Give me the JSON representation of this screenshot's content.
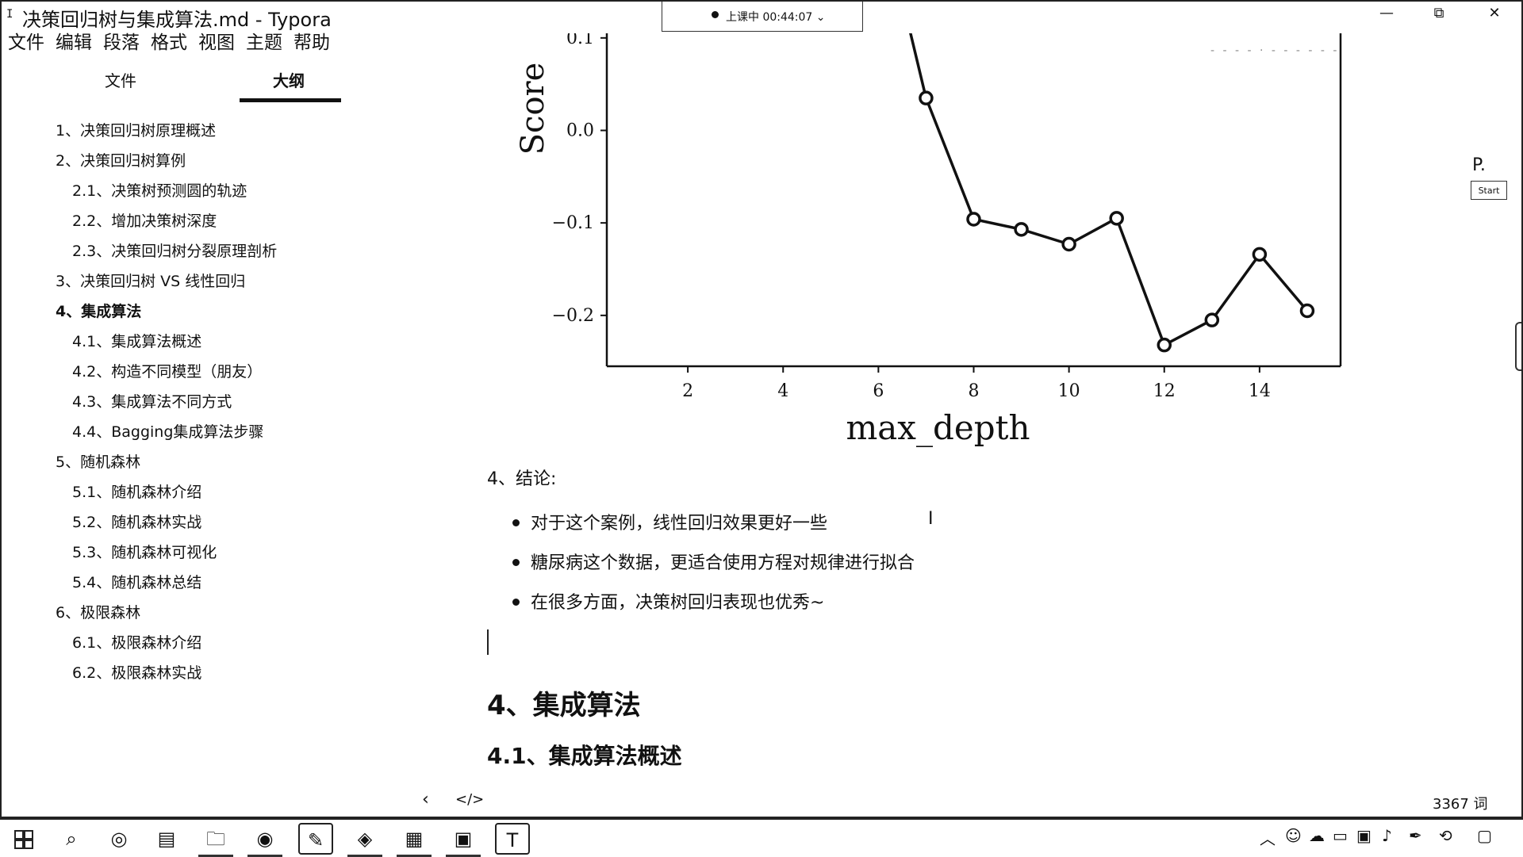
{
  "window": {
    "icon": "I",
    "title": "决策回归树与集成算法.md - Typora",
    "controls": {
      "minimize": "—",
      "maximize": "⧉",
      "close": "✕"
    }
  },
  "recorder": {
    "status": "上课中 00:44:07 ⌄"
  },
  "menu": [
    "文件",
    "编辑",
    "段落",
    "格式",
    "视图",
    "主题",
    "帮助"
  ],
  "sidebar": {
    "tabs": [
      {
        "label": "文件"
      },
      {
        "label": "大纲"
      }
    ],
    "active_tab": "大纲",
    "outline": [
      {
        "label": "1、决策回归树原理概述",
        "level": 1
      },
      {
        "label": "2、决策回归树算例",
        "level": 1
      },
      {
        "label": "2.1、决策树预测圆的轨迹",
        "level": 2
      },
      {
        "label": "2.2、增加决策树深度",
        "level": 2
      },
      {
        "label": "2.3、决策回归树分裂原理剖析",
        "level": 2
      },
      {
        "label": "3、决策回归树 VS 线性回归",
        "level": 1
      },
      {
        "label": "4、集成算法",
        "level": 1,
        "active": true
      },
      {
        "label": "4.1、集成算法概述",
        "level": 2
      },
      {
        "label": "4.2、构造不同模型（朋友）",
        "level": 2
      },
      {
        "label": "4.3、集成算法不同方式",
        "level": 2
      },
      {
        "label": "4.4、Bagging集成算法步骤",
        "level": 2
      },
      {
        "label": "5、随机森林",
        "level": 1
      },
      {
        "label": "5.1、随机森林介绍",
        "level": 2
      },
      {
        "label": "5.2、随机森林实战",
        "level": 2
      },
      {
        "label": "5.3、随机森林可视化",
        "level": 2
      },
      {
        "label": "5.4、随机森林总结",
        "level": 2
      },
      {
        "label": "6、极限森林",
        "level": 1
      },
      {
        "label": "6.1、极限森林介绍",
        "level": 2
      },
      {
        "label": "6.2、极限森林实战",
        "level": 2
      }
    ]
  },
  "chart_data": {
    "type": "line",
    "title": "",
    "xlabel": "max_depth",
    "ylabel": "Score",
    "xlim": [
      0.3,
      15.7
    ],
    "ylim": [
      -0.255,
      0.105
    ],
    "xticks": [
      2,
      4,
      6,
      8,
      10,
      12,
      14
    ],
    "yticks": [
      0.1,
      0.0,
      -0.1,
      -0.2
    ],
    "ytick_labels": [
      "0.1",
      "0.0",
      "−0.1",
      "−0.2"
    ],
    "series": [
      {
        "x": [
          6,
          7,
          8,
          9,
          10,
          11,
          12,
          13,
          14,
          15
        ],
        "y": [
          0.25,
          0.035,
          -0.096,
          -0.107,
          -0.123,
          -0.095,
          -0.232,
          -0.205,
          -0.134,
          -0.195
        ],
        "marker": "circle-open",
        "marker_from_index": 1
      }
    ],
    "grid": false
  },
  "document": {
    "conclusion_heading": "4、结论:",
    "bullets": [
      "对于这个案例，线性回归效果更好一些",
      "糖尿病这个数据，更适合使用方程对规律进行拟合",
      "在很多方面，决策树回归表现也优秀~"
    ],
    "h2": "4、集成算法",
    "h3": "4.1、集成算法概述"
  },
  "side_widget": {
    "label": "P.",
    "button": "Start"
  },
  "statusbar": {
    "back": "‹",
    "source_mode": "</>",
    "word_count": "3367 词"
  },
  "taskbar": {
    "apps": [
      "windows-start",
      "search",
      "cortana",
      "task-view",
      "file-explorer",
      "chrome",
      "pen-tool",
      "sketch",
      "presentation",
      "media",
      "typora"
    ],
    "tray": [
      "chevron-up",
      "qq",
      "cloud",
      "display",
      "monitor",
      "volume",
      "pen",
      "input",
      "notification"
    ]
  }
}
